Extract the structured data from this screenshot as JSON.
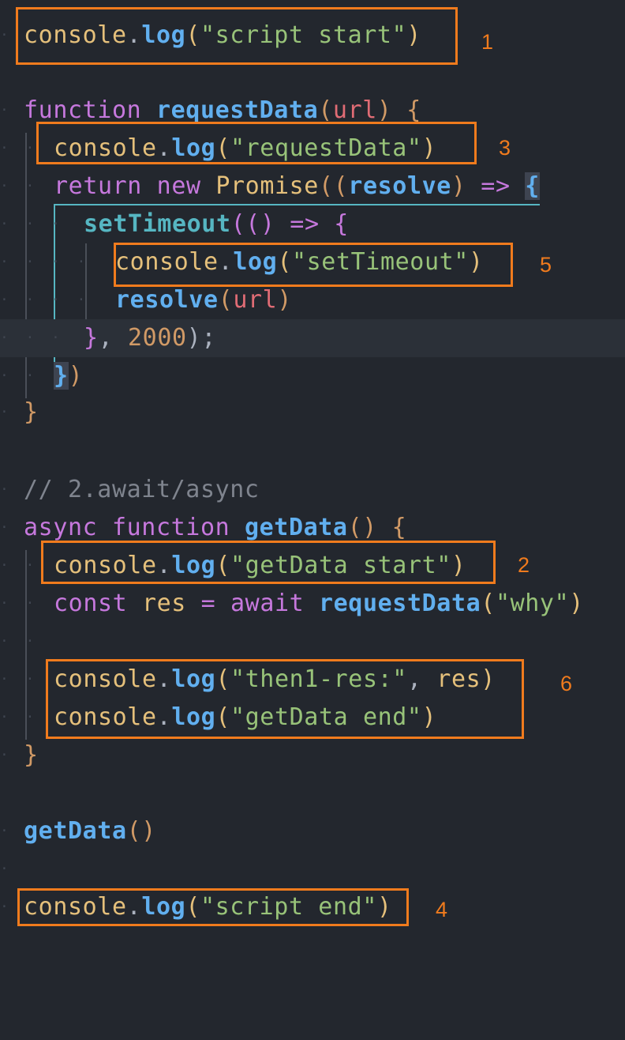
{
  "code": {
    "l1": {
      "con": "console",
      "dot": ".",
      "log": "log",
      "open": "(",
      "str": "\"script start\"",
      "close": ")"
    },
    "l3": {
      "kw": "function",
      "name": "requestData",
      "open": "(",
      "param": "url",
      "close": ")",
      "brace": "{"
    },
    "l4": {
      "con": "console",
      "dot": ".",
      "log": "log",
      "open": "(",
      "str": "\"requestData\"",
      "close": ")"
    },
    "l5": {
      "ret": "return",
      "new": "new",
      "promise": "Promise",
      "open": "((",
      "param": "resolve",
      "close": ")",
      "arrow": "=>",
      "brace": "{"
    },
    "l6": {
      "name": "setTimeout",
      "open": "(()",
      "arrow": "=>",
      "brace": "{"
    },
    "l7": {
      "con": "console",
      "dot": ".",
      "log": "log",
      "open": "(",
      "str": "\"setTimeout\"",
      "close": ")"
    },
    "l8": {
      "name": "resolve",
      "open": "(",
      "param": "url",
      "close": ")"
    },
    "l9": {
      "brace": "}",
      "comma": ",",
      "num": "2000",
      "end": ");"
    },
    "l10": {
      "brace": "}",
      "close": ")"
    },
    "l11": {
      "brace": "}"
    },
    "l13": {
      "comment": "// 2.await/async"
    },
    "l14": {
      "async": "async",
      "kw": "function",
      "name": "getData",
      "open": "()",
      "brace": "{"
    },
    "l15": {
      "con": "console",
      "dot": ".",
      "log": "log",
      "open": "(",
      "str": "\"getData start\"",
      "close": ")"
    },
    "l16": {
      "const": "const",
      "var": "res",
      "eq": "=",
      "await": "await",
      "name": "requestData",
      "open": "(",
      "str": "\"why\"",
      "close": ")"
    },
    "l18": {
      "con": "console",
      "dot": ".",
      "log": "log",
      "open": "(",
      "str": "\"then1-res:\"",
      "comma": ",",
      "var": "res",
      "close": ")"
    },
    "l19": {
      "con": "console",
      "dot": ".",
      "log": "log",
      "open": "(",
      "str": "\"getData end\"",
      "close": ")"
    },
    "l20": {
      "brace": "}"
    },
    "l22": {
      "name": "getData",
      "open": "()"
    },
    "l24": {
      "con": "console",
      "dot": ".",
      "log": "log",
      "open": "(",
      "str": "\"script end\"",
      "close": ")"
    }
  },
  "annotations": {
    "n1": "1",
    "n2": "2",
    "n3": "3",
    "n4": "4",
    "n5": "5",
    "n6": "6"
  },
  "colors": {
    "box": "#f07b1d",
    "background": "#23272e"
  }
}
